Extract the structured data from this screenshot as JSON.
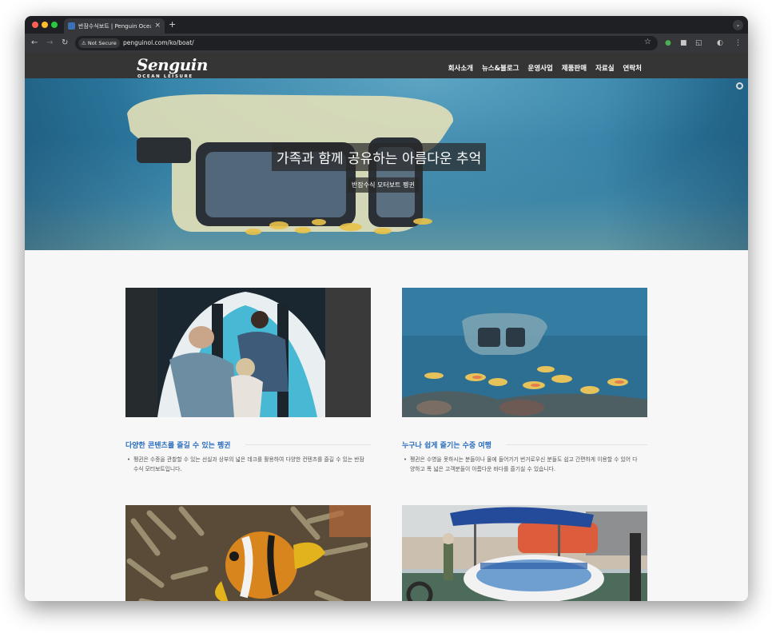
{
  "browser": {
    "tab_title": "반잠수식보트 | Penguin Ocean L",
    "tab_close": "×",
    "new_tab": "+",
    "security_label": "⚠ Not Secure",
    "url": "penguinol.com/ko/boat/"
  },
  "site": {
    "logo_text": "Senguin",
    "logo_subtitle": "OCEAN LEISURE",
    "nav": [
      "회사소개",
      "뉴스&블로그",
      "운영사업",
      "제품판매",
      "자료실",
      "연락처"
    ]
  },
  "hero": {
    "title": "가족과 함께 공유하는 아름다운 추억",
    "subtitle": "반잠수식 모터보트 펭귄"
  },
  "features": [
    {
      "title": "다양한 콘텐츠를 즐길 수 있는 펭귄",
      "description": "펭귄은 수중을 관찰할 수 있는 선실과 상부의 넓은 데크를 활용하여 다양한 컨텐츠를 즐길 수 있는 반잠수식 모터보트입니다."
    },
    {
      "title": "누구나 쉽게 즐기는 수중 여행",
      "description": "펭귄은 수영을 못하시는 분들이나 물에 들어가기 번거로우신 분들도 쉽고 간편하게 이용할 수 있어 다양하고 폭 넓은 고객분들이 아름다운 바다를 즐기실 수 있습니다."
    }
  ]
}
